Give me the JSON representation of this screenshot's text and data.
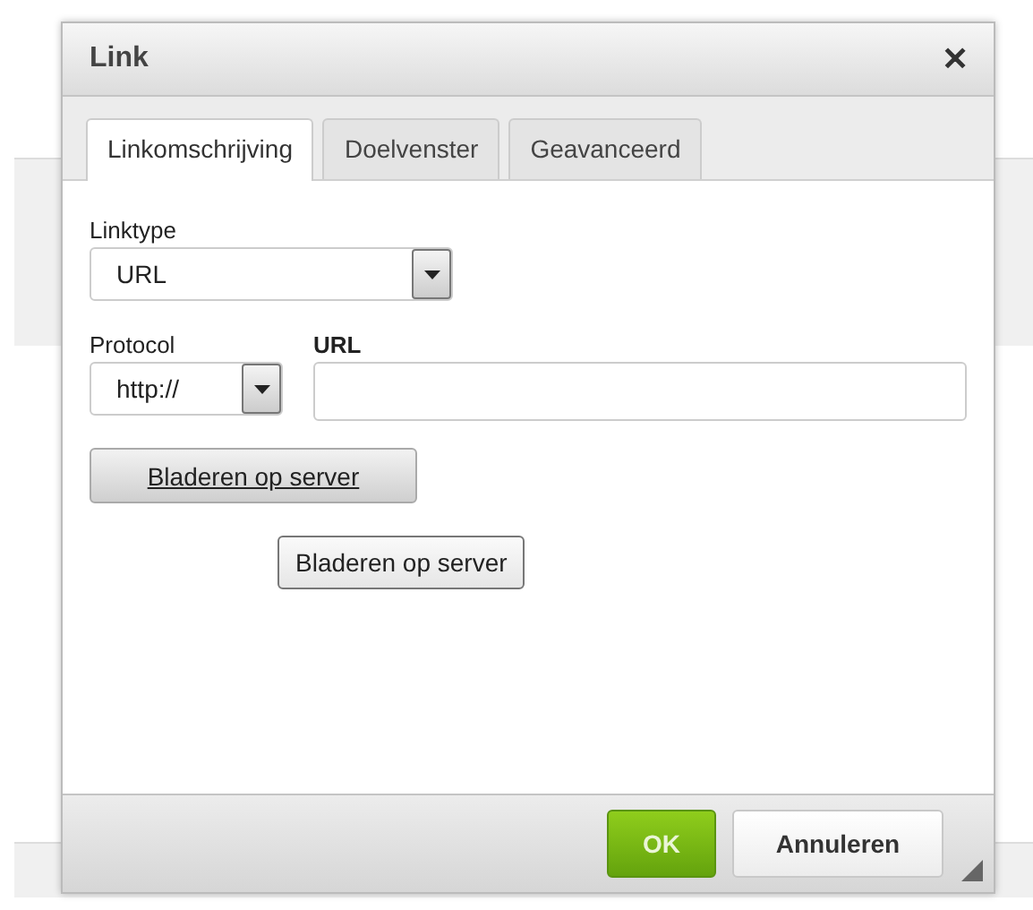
{
  "dialog": {
    "title": "Link",
    "close": "✕"
  },
  "tabs": [
    {
      "label": "Linkomschrijving",
      "selected": true
    },
    {
      "label": "Doelvenster",
      "selected": false
    },
    {
      "label": "Geavanceerd",
      "selected": false
    }
  ],
  "linktype": {
    "label": "Linktype",
    "value": "URL"
  },
  "protocol": {
    "label": "Protocol",
    "value": "http://"
  },
  "url": {
    "label": "URL"
  },
  "browse_buttons": [
    {
      "label": "Bladeren op server",
      "kind": "styled"
    },
    {
      "label": "Bladeren op server",
      "kind": "native"
    }
  ],
  "footer_buttons": [
    {
      "label": "OK",
      "kind": "primary"
    },
    {
      "label": "Annuleren",
      "kind": "secondary"
    }
  ]
}
